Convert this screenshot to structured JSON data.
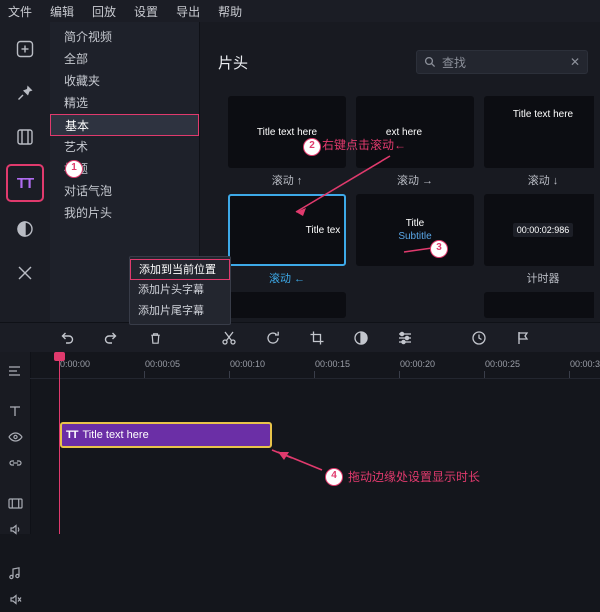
{
  "menubar": {
    "items": [
      "文件",
      "编辑",
      "回放",
      "设置",
      "导出",
      "帮助"
    ]
  },
  "rail": {
    "items": [
      {
        "name": "media-library-icon",
        "label": "媒体"
      },
      {
        "name": "pin-icon",
        "label": "贴纸"
      },
      {
        "name": "split-screen-icon",
        "label": "分屏"
      },
      {
        "name": "text-icon",
        "label": "TT"
      },
      {
        "name": "transition-icon",
        "label": "转场"
      },
      {
        "name": "effects-icon",
        "label": "特效"
      }
    ]
  },
  "categories": [
    {
      "label": "简介视频",
      "active": false,
      "marked": false
    },
    {
      "label": "全部",
      "active": false,
      "marked": false
    },
    {
      "label": "收藏夹",
      "active": false,
      "marked": false
    },
    {
      "label": "精选",
      "active": false,
      "marked": false
    },
    {
      "label": "基本",
      "active": true,
      "marked": true
    },
    {
      "label": "艺术",
      "active": false,
      "marked": false
    },
    {
      "label": "标题",
      "active": false,
      "marked": false
    },
    {
      "label": "对话气泡",
      "active": false,
      "marked": false
    },
    {
      "label": "我的片头",
      "active": false,
      "marked": false
    }
  ],
  "panel": {
    "title": "片头",
    "search_placeholder": "查找",
    "search_icon": "search-icon",
    "clear_icon": "close-icon"
  },
  "thumbnails": [
    {
      "text": "Title text here",
      "caption": "滚动 ↑",
      "caption_color": "normal",
      "selected": false
    },
    {
      "text": "ext here",
      "caption": "滚动 →",
      "caption_color": "normal",
      "selected": false
    },
    {
      "text": "Title text here",
      "caption": "滚动 ↓",
      "caption_color": "normal",
      "selected": false
    },
    {
      "text": "Title tex",
      "caption": "滚动 ←",
      "caption_color": "blue",
      "selected": true
    },
    {
      "text": "Title",
      "subtext": "Subtitle",
      "caption": "",
      "caption_color": "normal",
      "selected": false
    },
    {
      "text": "00:00:02:986",
      "caption": "计时器",
      "caption_color": "normal",
      "selected": false
    }
  ],
  "context_menu": {
    "items": [
      {
        "label": "添加到当前位置",
        "highlighted": true
      },
      {
        "label": "添加片头字幕",
        "highlighted": false
      },
      {
        "label": "添加片尾字幕",
        "highlighted": false
      }
    ]
  },
  "annotations": [
    {
      "id": "1",
      "text": ""
    },
    {
      "id": "2",
      "text": "右键点击滚动←"
    },
    {
      "id": "3",
      "text": ""
    },
    {
      "id": "4",
      "text": "拖动边缘处设置显示时长"
    }
  ],
  "toolbar": {
    "buttons": [
      {
        "name": "undo-button",
        "icon": "undo-icon"
      },
      {
        "name": "redo-button",
        "icon": "redo-icon"
      },
      {
        "name": "delete-button",
        "icon": "trash-icon"
      },
      {
        "name": "cut-button",
        "icon": "scissors-icon"
      },
      {
        "name": "rotate-button",
        "icon": "rotate-icon"
      },
      {
        "name": "crop-button",
        "icon": "crop-icon"
      },
      {
        "name": "color-button",
        "icon": "color-icon"
      },
      {
        "name": "adjust-button",
        "icon": "sliders-icon"
      },
      {
        "name": "speed-button",
        "icon": "speed-icon"
      },
      {
        "name": "marker-button",
        "icon": "flag-icon"
      }
    ]
  },
  "timeline": {
    "ticks": [
      "0:00:00",
      "00:00:05",
      "00:00:10",
      "00:00:15",
      "00:00:20",
      "00:00:25",
      "00:00:3"
    ],
    "rail_icons": [
      {
        "name": "track-options-icon"
      },
      {
        "name": "text-track-icon"
      },
      {
        "name": "eye-icon"
      },
      {
        "name": "link-icon"
      },
      {
        "name": "video-track-icon"
      },
      {
        "name": "eye-icon-2"
      },
      {
        "name": "speaker-icon"
      },
      {
        "name": "music-track-icon"
      },
      {
        "name": "speaker-icon-2"
      },
      {
        "name": "mute-icon"
      }
    ],
    "clip": {
      "icon": "TT",
      "label": "Title text here"
    }
  }
}
